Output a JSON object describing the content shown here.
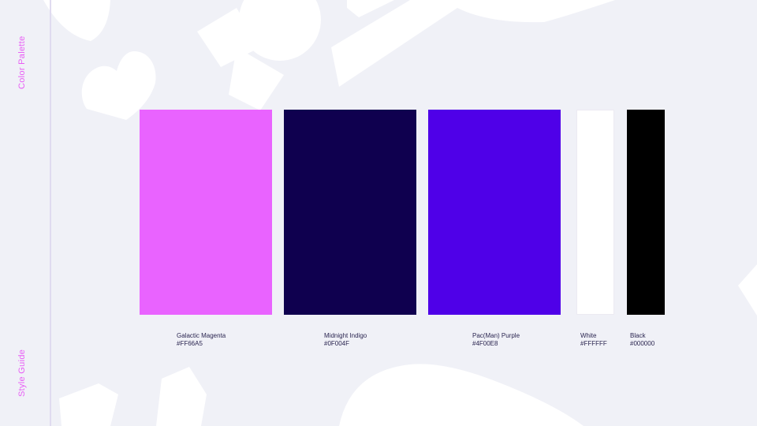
{
  "sidebar": {
    "section_label": "Color Palette",
    "doc_label": "Style Guide"
  },
  "colors": {
    "accent": "#E85EF5",
    "background": "#F0F1F7"
  },
  "palette": [
    {
      "name": "Galactic Magenta",
      "hex": "#FF66A5",
      "swatch": "#E963FF"
    },
    {
      "name": "Midnight Indigo",
      "hex": "#0F004F",
      "swatch": "#0F004F"
    },
    {
      "name": "Pac(Man) Purple",
      "hex": "#4F00E8",
      "swatch": "#4F00E8"
    },
    {
      "name": "White",
      "hex": "#FFFFFF",
      "swatch": "#FFFFFF"
    },
    {
      "name": "Black",
      "hex": "#000000",
      "swatch": "#000000"
    }
  ]
}
